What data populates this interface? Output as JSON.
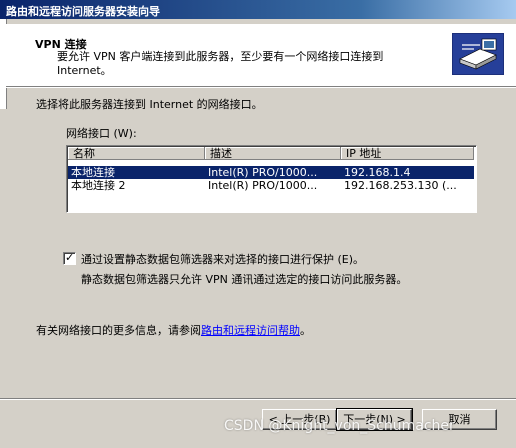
{
  "window": {
    "title": "路由和远程访问服务器安装向导"
  },
  "header": {
    "title": "VPN 连接",
    "description": "要允许 VPN 客户端连接到此服务器，至少要有一个网络接口连接到 Internet。"
  },
  "main": {
    "instruction": "选择将此服务器连接到 Internet 的网络接口。",
    "list_label": "网络接口 (W):",
    "columns": [
      "名称",
      "描述",
      "IP 地址"
    ],
    "rows": [
      {
        "name": "本地连接",
        "description": "Intel(R) PRO/1000...",
        "ip": "192.168.1.4"
      },
      {
        "name": "本地连接 2",
        "description": "Intel(R) PRO/1000...",
        "ip": "192.168.253.130  (..."
      }
    ],
    "selected_row": 0,
    "checkbox": {
      "checked": true,
      "label": "通过设置静态数据包筛选器来对选择的接口进行保护 (E)。",
      "description": "静态数据包筛选器只允许 VPN 通讯通过选定的接口访问此服务器。"
    },
    "more_info_prefix": "有关网络接口的更多信息，请参阅",
    "help_link": "路由和远程访问帮助",
    "more_info_suffix": "。"
  },
  "buttons": {
    "back": "< 上一步(B)",
    "next": "下一步(N) >",
    "cancel": "取消"
  },
  "watermark": "CSDN @Knight_von_Schumacher",
  "icons": {
    "wizard": "network-wizard-icon",
    "check": "checkmark-icon"
  },
  "colors": {
    "title_bar": "#0a246a",
    "selection": "#0a246a",
    "face": "#d4d0c8",
    "link": "#0000ff"
  }
}
